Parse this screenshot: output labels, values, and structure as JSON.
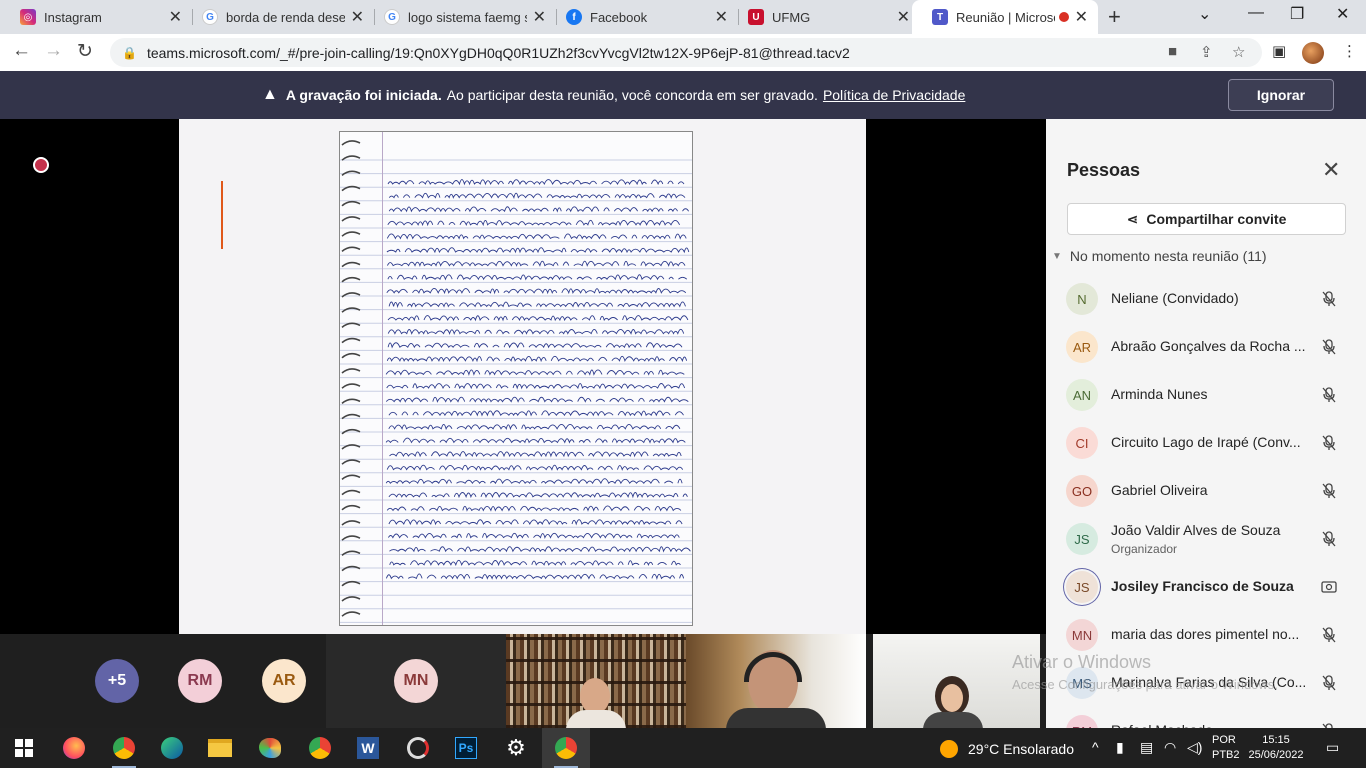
{
  "browser": {
    "tabs": [
      {
        "title": "Instagram",
        "icon": "instagram-icon"
      },
      {
        "title": "borda de renda desenho",
        "icon": "google-icon"
      },
      {
        "title": "logo sistema faemg senar",
        "icon": "google-icon"
      },
      {
        "title": "Facebook",
        "icon": "facebook-icon"
      },
      {
        "title": "UFMG",
        "icon": "ufmg-icon"
      },
      {
        "title": "Reunião | Microsoft Teams",
        "icon": "teams-icon"
      }
    ],
    "url": "teams.microsoft.com/_#/pre-join-calling/19:Qn0XYgDH0qQ0R1UZh2f3cvYvcgVl2tw12X-9P6ejP-81@thread.tacv2"
  },
  "banner": {
    "bold": "A gravação foi iniciada.",
    "text": "Ao participar desta reunião, você concorda em ser gravado.",
    "link": "Política de Privacidade",
    "ignore": "Ignorar"
  },
  "gallery": {
    "overflow": "+5",
    "avatars": [
      {
        "initials": "RM",
        "bg": "#f3cfd8",
        "fg": "#8b3a50"
      },
      {
        "initials": "AR",
        "bg": "#fbe6cc",
        "fg": "#9a5a10"
      }
    ],
    "mn_tile": "MN"
  },
  "panel": {
    "title": "Pessoas",
    "share": "Compartilhar convite",
    "section": "No momento nesta reunião (11)",
    "people": [
      {
        "initials": "N",
        "name": "Neliane (Convidado)",
        "role": "",
        "bg": "#e3e8d8",
        "fg": "#556b2f"
      },
      {
        "initials": "AR",
        "name": "Abraão Gonçalves da Rocha ...",
        "role": "",
        "bg": "#fbe6cc",
        "fg": "#9a5a10"
      },
      {
        "initials": "AN",
        "name": "Arminda Nunes",
        "role": "",
        "bg": "#e3eedb",
        "fg": "#4a6b35"
      },
      {
        "initials": "CI",
        "name": "Circuito Lago de Irapé (Conv...",
        "role": "",
        "bg": "#fadbd6",
        "fg": "#a13a2a"
      },
      {
        "initials": "GO",
        "name": "Gabriel Oliveira",
        "role": "",
        "bg": "#f6d6cd",
        "fg": "#8a2f1f"
      },
      {
        "initials": "JS",
        "name": "João Valdir Alves de Souza",
        "role": "Organizador",
        "bg": "#d6ebe0",
        "fg": "#2f6b4a"
      },
      {
        "initials": "JS",
        "name": "Josiley Francisco de Souza",
        "role": "",
        "bg": "#efe2d8",
        "fg": "#7a4a2a"
      },
      {
        "initials": "MN",
        "name": "maria das dores pimentel no...",
        "role": "",
        "bg": "#f3d6d6",
        "fg": "#8b3a3a"
      },
      {
        "initials": "MS",
        "name": "Marinalva Farias da Silva (Co...",
        "role": "",
        "bg": "#dde6ef",
        "fg": "#3a5a7a"
      },
      {
        "initials": "RM",
        "name": "Rafael Machado",
        "role": "",
        "bg": "#f3cfd8",
        "fg": "#8b3a50"
      }
    ]
  },
  "watermark": {
    "line1": "Ativar o Windows",
    "line2": "Acesse Configurações para ativar o Windows."
  },
  "taskbar": {
    "weather": "29°C  Ensolarado",
    "lang1": "POR",
    "lang2": "PTB2",
    "time": "15:15",
    "date": "25/06/2022"
  }
}
